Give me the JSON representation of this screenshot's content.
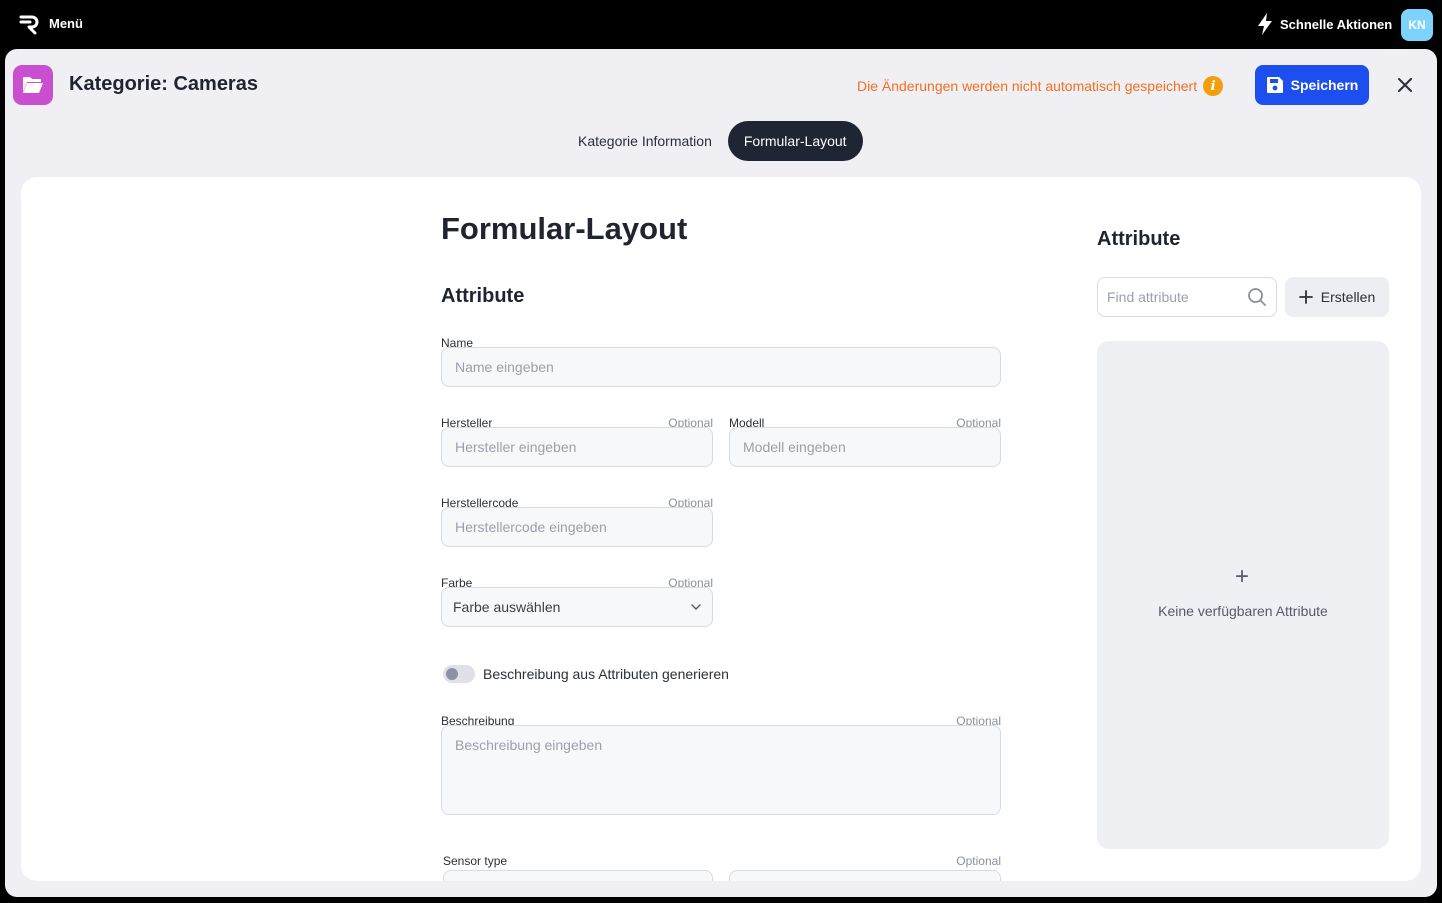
{
  "topbar": {
    "menu_label": "Menü",
    "quick_actions_label": "Schnelle Aktionen",
    "avatar_initials": "KN"
  },
  "header": {
    "title": "Kategorie: Cameras",
    "unsaved_notice": "Die Änderungen werden nicht automatisch gespeichert",
    "info_symbol": "i",
    "save_label": "Speichern"
  },
  "tabs": [
    {
      "label": "Kategorie Information",
      "active": false
    },
    {
      "label": "Formular-Layout",
      "active": true
    }
  ],
  "form": {
    "title": "Formular-Layout",
    "section_title": "Attribute",
    "optional_label": "Optional",
    "fields": {
      "name": {
        "label": "Name",
        "placeholder": "Name eingeben"
      },
      "hersteller": {
        "label": "Hersteller",
        "placeholder": "Hersteller eingeben"
      },
      "modell": {
        "label": "Modell",
        "placeholder": "Modell eingeben"
      },
      "herstellercode": {
        "label": "Herstellercode",
        "placeholder": "Herstellercode eingeben"
      },
      "farbe": {
        "label": "Farbe",
        "value": "Farbe auswählen"
      },
      "beschreibung": {
        "label": "Beschreibung",
        "placeholder": "Beschreibung eingeben"
      },
      "sensor_type": {
        "label": "Sensor type"
      }
    },
    "toggle_label": "Beschreibung aus Attributen generieren",
    "toggle_on": false
  },
  "attributes_panel": {
    "title": "Attribute",
    "search_placeholder": "Find attribute",
    "create_label": "Erstellen",
    "empty_plus": "+",
    "empty_text": "Keine verfügbaren Attribute"
  },
  "colors": {
    "accent": "#1d4ff0",
    "warning": "#f2711c",
    "category_icon": "#c94fd0",
    "active_tab": "#1e2533",
    "avatar": "#7dd3fc"
  },
  "icons": [
    "logo-icon",
    "lightning-icon",
    "folder-icon",
    "info-icon",
    "save-icon",
    "close-icon",
    "chevron-down-icon",
    "search-icon",
    "plus-icon"
  ]
}
